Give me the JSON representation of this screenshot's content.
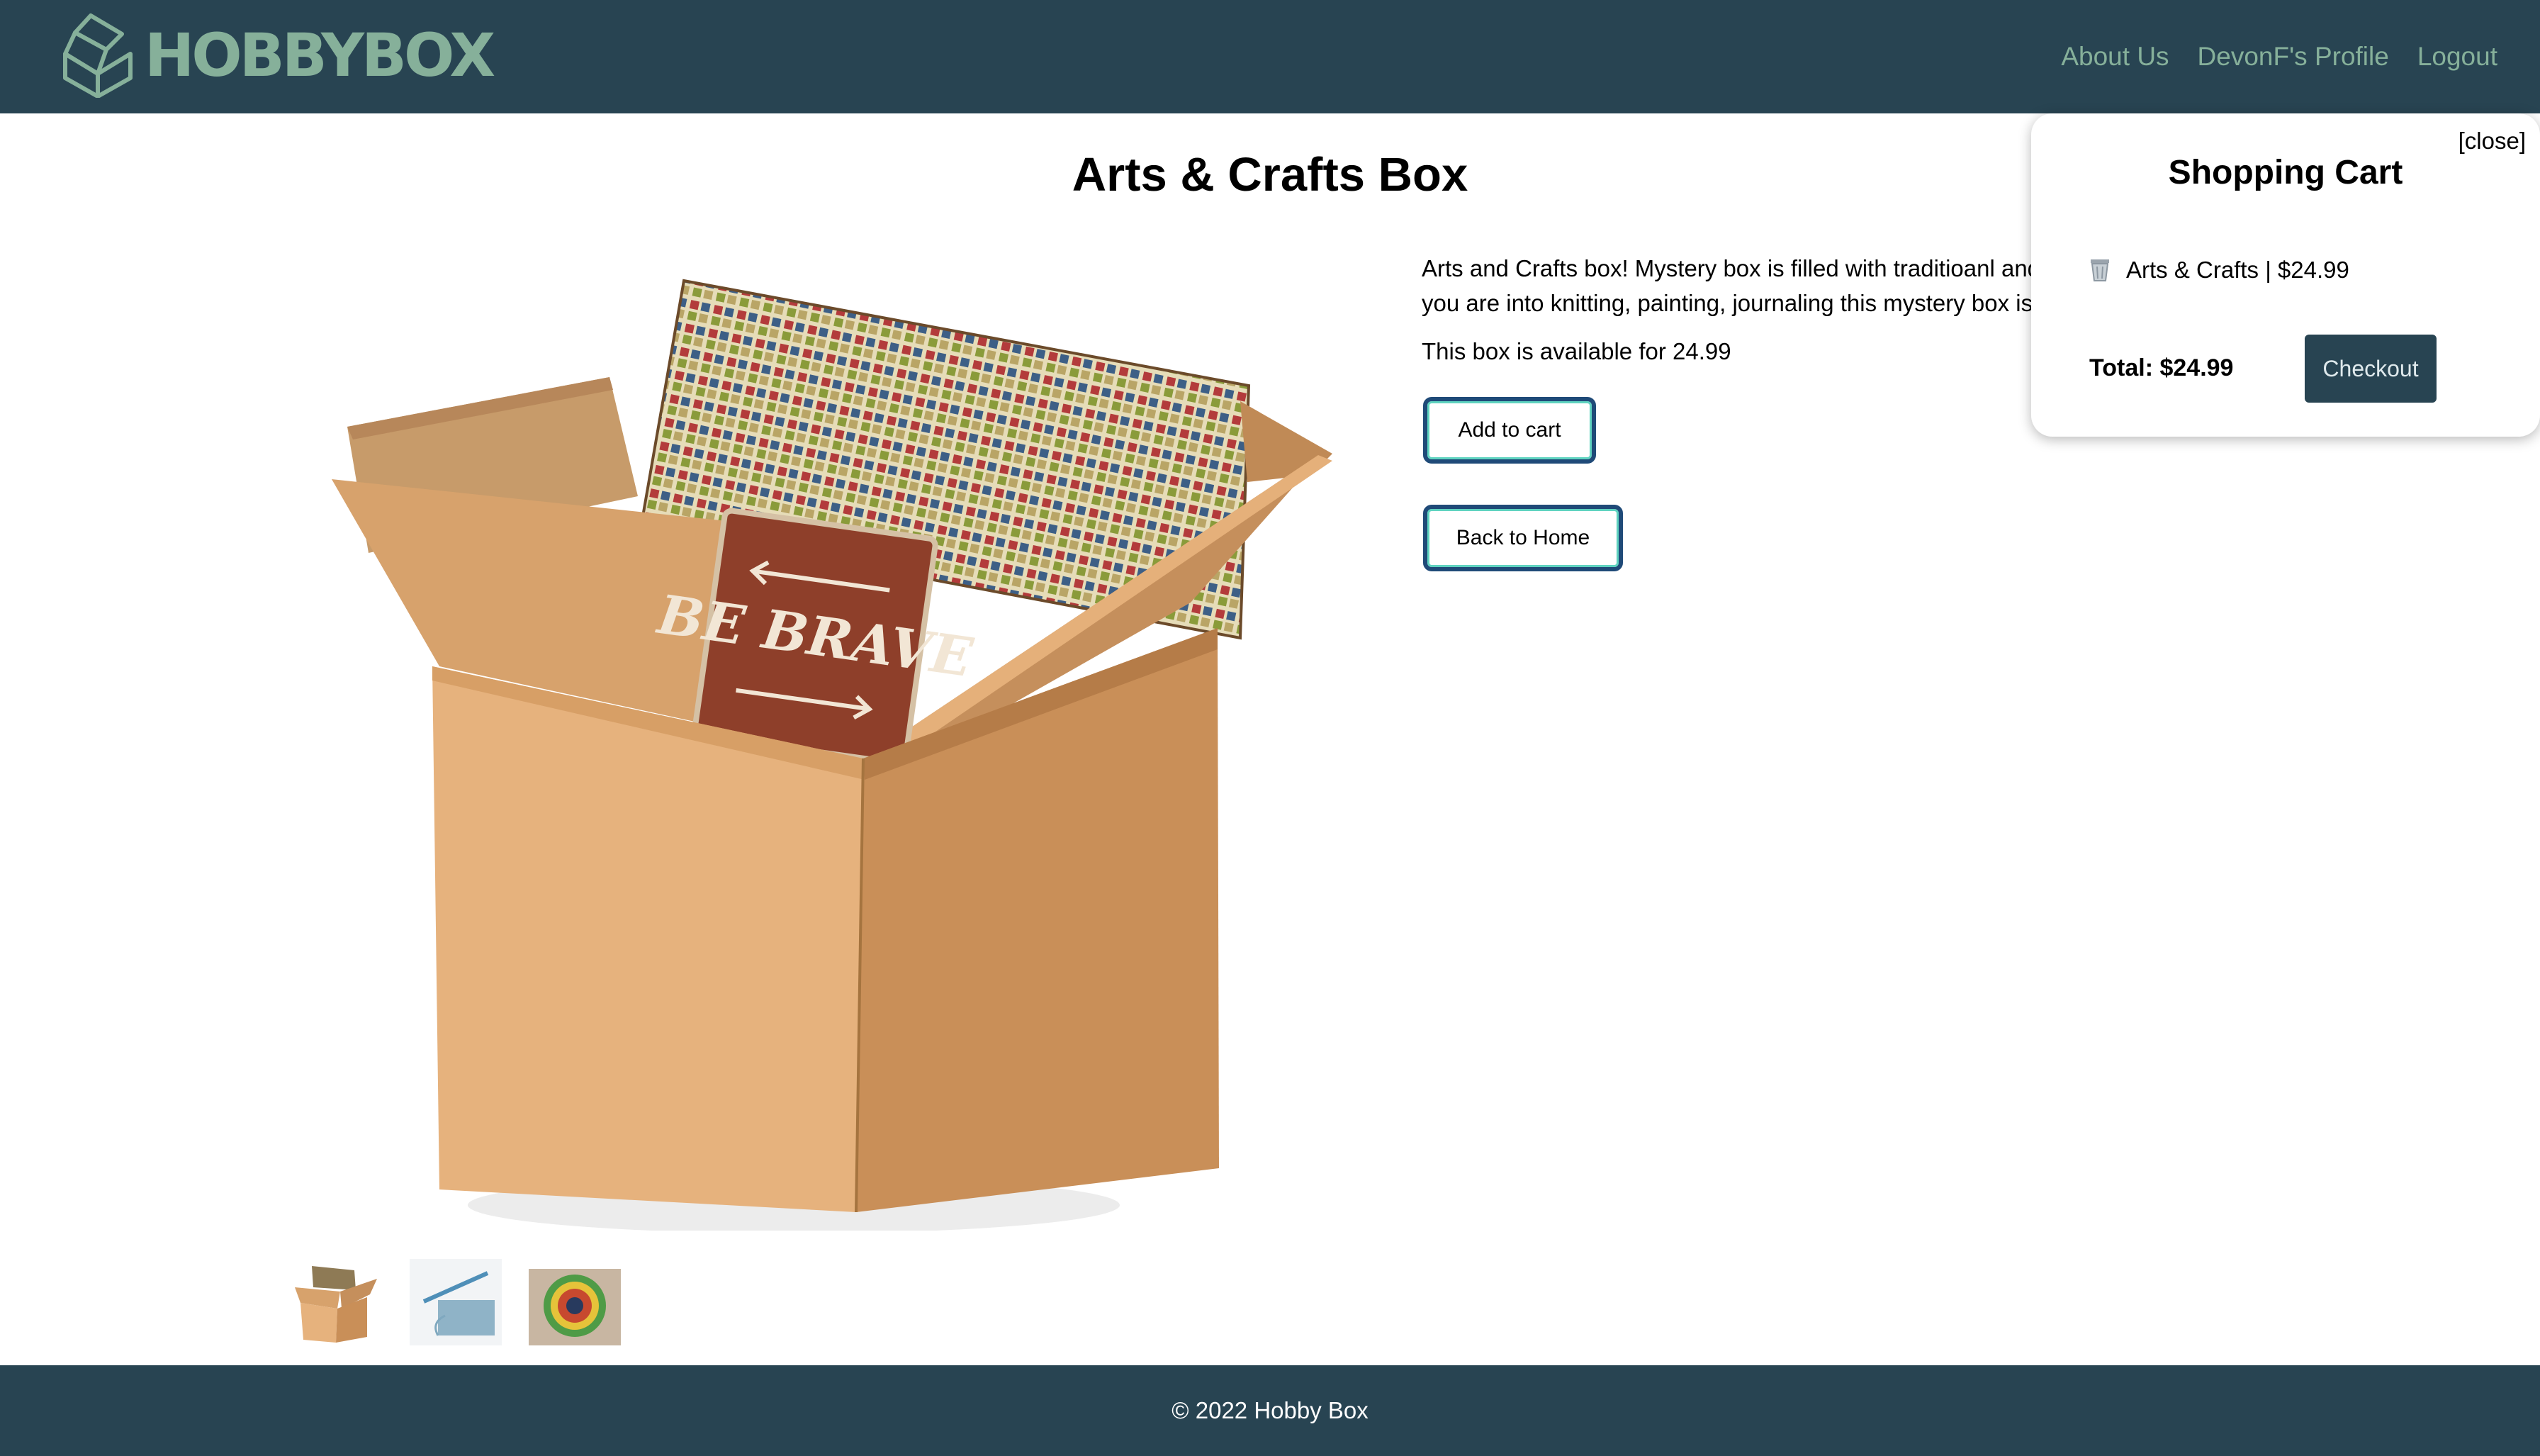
{
  "header": {
    "logo_text": "HOBBYBOX",
    "nav": [
      "About Us",
      "DevonF's Profile",
      "Logout"
    ]
  },
  "product": {
    "title": "Arts & Crafts Box",
    "description": "Arts and Crafts box! Mystery box is filled with traditioanl and modern arts and crafts. If you are into knitting, painting, journaling this mystery box is for you!",
    "availability": "This box is available for 24.99",
    "sign_text": "BE BRAVE",
    "add_to_cart_label": "Add to cart",
    "back_home_label": "Back to Home"
  },
  "cart": {
    "close_label": "[close]",
    "title": "Shopping Cart",
    "item": "Arts & Crafts | $24.99",
    "total": "Total: $24.99",
    "checkout_label": "Checkout"
  },
  "footer": {
    "copyright": "© 2022 Hobby Box"
  },
  "colors": {
    "header_bg": "#284452",
    "accent": "#86b09a",
    "button_border": "#1f4a78",
    "button_glow": "#5fd3c0"
  },
  "icons": [
    "box-logo-icon",
    "trash-icon"
  ]
}
